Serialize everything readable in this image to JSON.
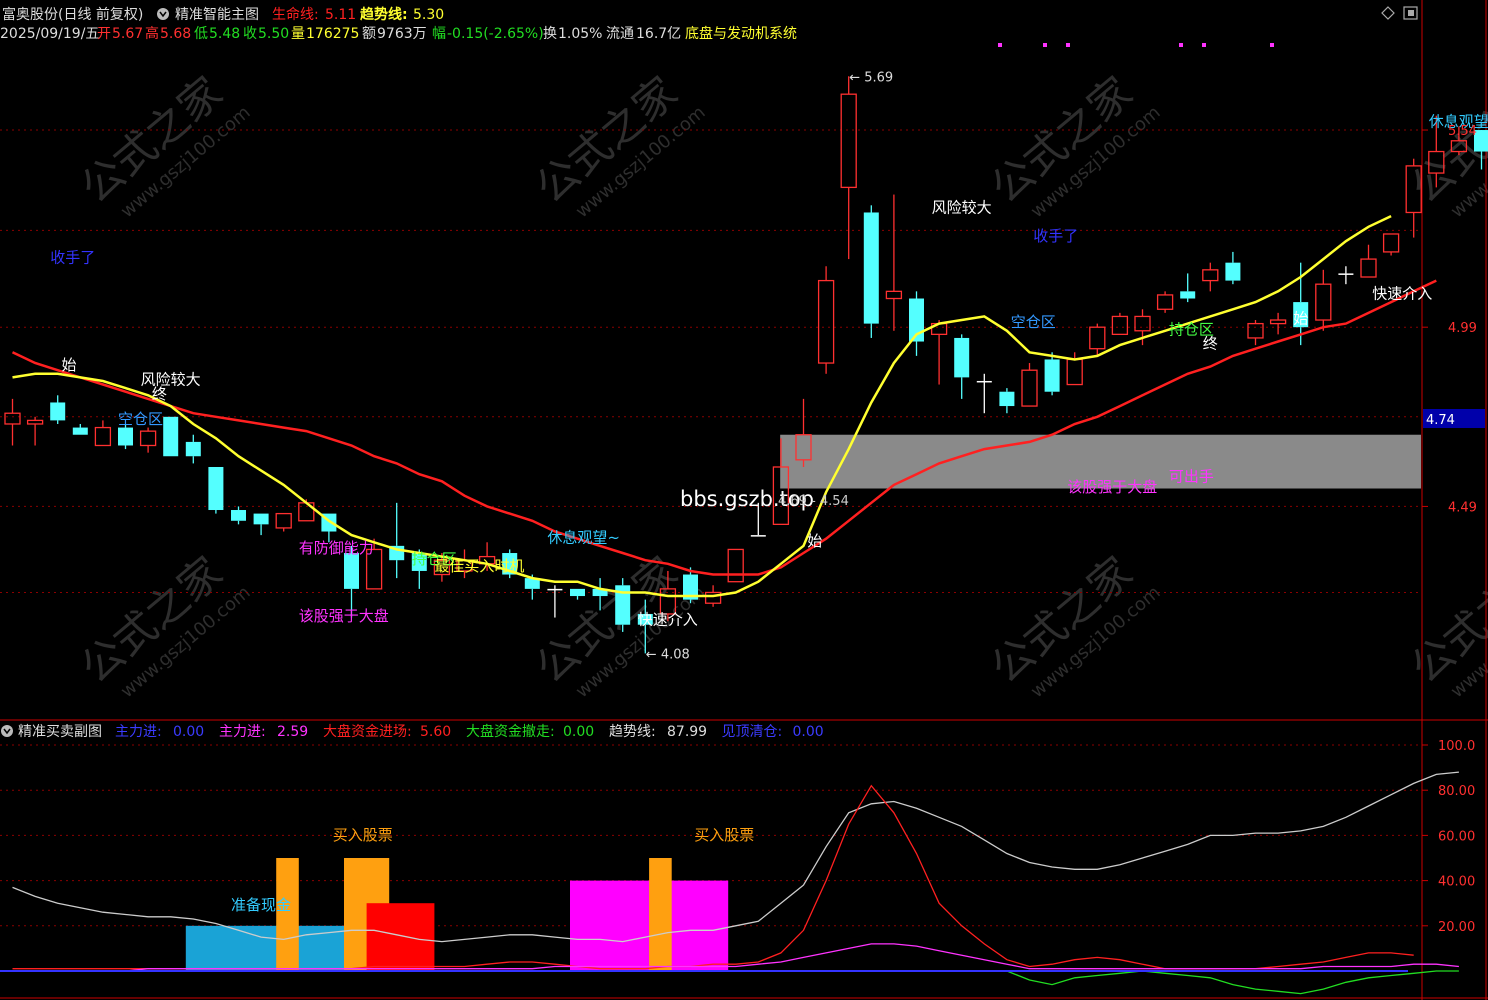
{
  "header": {
    "stock": "富奥股份(日线 前复权)",
    "indicator": "精准智能主图",
    "life_label": "生命线:",
    "life_value": "5.11",
    "trend_label": "趋势线:",
    "trend_value": "5.30",
    "date": "2025/09/19/五",
    "open_label": "开",
    "open": "5.67",
    "high_label": "高",
    "high": "5.68",
    "low_label": "低",
    "low": "5.48",
    "close_label": "收",
    "close": "5.50",
    "vol_label": "量",
    "vol": "176275",
    "amt_label": "额",
    "amt": "9763万",
    "chg_label": "幅",
    "chg": "-0.15(-2.65%)",
    "turn_label": "换",
    "turn": "1.05%",
    "float_label": "流通",
    "float": "16.7亿",
    "system": "底盘与发动机系统"
  },
  "sub_header": {
    "title": "精准买卖副图",
    "items": [
      {
        "label": "主力进:",
        "value": "0.00",
        "color": "#3b3bff"
      },
      {
        "label": "主力进:",
        "value": "2.59",
        "color": "#ff33ff"
      },
      {
        "label": "大盘资金进场:",
        "value": "5.60",
        "color": "#ff2020"
      },
      {
        "label": "大盘资金撤走:",
        "value": "0.00",
        "color": "#22dd22"
      },
      {
        "label": "趋势线:",
        "value": "87.99",
        "color": "#dddddd"
      },
      {
        "label": "见顶清仓:",
        "value": "0.00",
        "color": "#3b3bff"
      }
    ]
  },
  "watermark": {
    "text": "公式之家",
    "url": "www.gszj100.com"
  },
  "site_text": "bbs.gszb.top",
  "zone_text": "4.69 - 4.54",
  "colors": {
    "up": "#ff3030",
    "down": "#54ffff",
    "life": "#ff2020",
    "trend": "#ffff30",
    "grid": "#8b0000",
    "axis": "#cc0000"
  },
  "main_axis": {
    "ticks": [
      "5.54",
      "4.99",
      "4.49"
    ],
    "current": "4.74"
  },
  "sub_axis": {
    "ticks": [
      "100.0",
      "80.00",
      "60.00",
      "40.00",
      "20.00"
    ]
  },
  "chart_data": {
    "type": "candlestick",
    "ylim": [
      3.95,
      5.78
    ],
    "candles": [
      [
        4.72,
        4.75,
        4.66,
        4.79
      ],
      [
        4.72,
        4.73,
        4.66,
        4.74
      ],
      [
        4.78,
        4.73,
        4.72,
        4.8
      ],
      [
        4.71,
        4.69,
        4.69,
        4.72
      ],
      [
        4.66,
        4.71,
        4.66,
        4.73
      ],
      [
        4.71,
        4.66,
        4.65,
        4.72
      ],
      [
        4.66,
        4.7,
        4.64,
        4.71
      ],
      [
        4.74,
        4.63,
        4.63,
        4.74
      ],
      [
        4.67,
        4.63,
        4.61,
        4.69
      ],
      [
        4.6,
        4.48,
        4.47,
        4.6
      ],
      [
        4.48,
        4.45,
        4.44,
        4.49
      ],
      [
        4.47,
        4.44,
        4.41,
        4.47
      ],
      [
        4.43,
        4.47,
        4.42,
        4.47
      ],
      [
        4.45,
        4.5,
        4.45,
        4.51
      ],
      [
        4.47,
        4.42,
        4.39,
        4.47
      ],
      [
        4.36,
        4.26,
        4.18,
        4.38
      ],
      [
        4.26,
        4.37,
        4.26,
        4.4
      ],
      [
        4.38,
        4.34,
        4.29,
        4.5
      ],
      [
        4.36,
        4.31,
        4.26,
        4.37
      ],
      [
        4.3,
        4.34,
        4.28,
        4.36
      ],
      [
        4.31,
        4.34,
        4.29,
        4.37
      ],
      [
        4.33,
        4.35,
        4.31,
        4.39
      ],
      [
        4.36,
        4.3,
        4.29,
        4.37
      ],
      [
        4.29,
        4.26,
        4.23,
        4.3
      ],
      [
        4.26,
        4.26,
        4.18,
        4.27
      ],
      [
        4.26,
        4.24,
        4.23,
        4.26
      ],
      [
        4.26,
        4.24,
        4.2,
        4.29
      ],
      [
        4.27,
        4.16,
        4.14,
        4.29
      ],
      [
        4.19,
        4.16,
        4.08,
        4.23
      ],
      [
        4.19,
        4.26,
        4.17,
        4.31
      ],
      [
        4.3,
        4.23,
        4.22,
        4.32
      ],
      [
        4.22,
        4.25,
        4.21,
        4.27
      ],
      [
        4.28,
        4.37,
        4.28,
        4.37
      ],
      [
        4.41,
        4.41,
        4.41,
        4.5
      ],
      [
        4.44,
        4.6,
        4.44,
        4.68
      ],
      [
        4.62,
        4.69,
        4.6,
        4.79
      ],
      [
        4.89,
        5.12,
        4.86,
        5.16
      ],
      [
        5.38,
        5.64,
        5.18,
        5.69
      ],
      [
        5.31,
        5.0,
        4.96,
        5.33
      ],
      [
        5.07,
        5.09,
        4.98,
        5.36
      ],
      [
        5.07,
        4.95,
        4.91,
        5.09
      ],
      [
        4.97,
        5.0,
        4.83,
        5.01
      ],
      [
        4.96,
        4.85,
        4.79,
        4.97
      ],
      [
        4.84,
        4.84,
        4.75,
        4.86
      ],
      [
        4.81,
        4.77,
        4.75,
        4.82
      ],
      [
        4.77,
        4.87,
        4.77,
        4.89
      ],
      [
        4.9,
        4.81,
        4.8,
        4.92
      ],
      [
        4.83,
        4.9,
        4.83,
        4.92
      ],
      [
        4.93,
        4.99,
        4.91,
        5.0
      ],
      [
        4.97,
        5.02,
        4.97,
        5.03
      ],
      [
        4.98,
        5.02,
        4.94,
        5.04
      ],
      [
        5.04,
        5.08,
        5.03,
        5.09
      ],
      [
        5.09,
        5.07,
        5.06,
        5.14
      ],
      [
        5.12,
        5.15,
        5.09,
        5.17
      ],
      [
        5.17,
        5.12,
        5.11,
        5.2
      ],
      [
        4.96,
        5.0,
        4.94,
        5.01
      ],
      [
        5.0,
        5.01,
        4.97,
        5.03
      ],
      [
        5.06,
        4.99,
        4.94,
        5.17
      ],
      [
        5.01,
        5.11,
        4.98,
        5.15
      ],
      [
        5.14,
        5.14,
        5.11,
        5.16
      ],
      [
        5.13,
        5.18,
        5.13,
        5.22
      ],
      [
        5.2,
        5.25,
        5.19,
        5.25
      ],
      [
        5.31,
        5.44,
        5.24,
        5.46
      ],
      [
        5.42,
        5.48,
        5.38,
        5.58
      ],
      [
        5.48,
        5.51,
        5.47,
        5.55
      ],
      [
        5.54,
        5.48,
        5.43,
        5.53
      ]
    ],
    "life_line": [
      4.92,
      4.89,
      4.87,
      4.85,
      4.83,
      4.81,
      4.79,
      4.77,
      4.75,
      4.74,
      4.73,
      4.72,
      4.71,
      4.7,
      4.68,
      4.66,
      4.63,
      4.61,
      4.58,
      4.56,
      4.52,
      4.49,
      4.47,
      4.45,
      4.42,
      4.4,
      4.38,
      4.36,
      4.34,
      4.33,
      4.31,
      4.3,
      4.3,
      4.3,
      4.32,
      4.36,
      4.4,
      4.45,
      4.5,
      4.55,
      4.58,
      4.61,
      4.63,
      4.65,
      4.66,
      4.67,
      4.69,
      4.72,
      4.74,
      4.77,
      4.8,
      4.83,
      4.86,
      4.88,
      4.91,
      4.93,
      4.95,
      4.97,
      4.99,
      5.0,
      5.03,
      5.06,
      5.09,
      5.12
    ],
    "trend_line": [
      4.85,
      4.86,
      4.86,
      4.85,
      4.84,
      4.82,
      4.8,
      4.77,
      4.72,
      4.68,
      4.63,
      4.59,
      4.55,
      4.5,
      4.45,
      4.41,
      4.39,
      4.37,
      4.36,
      4.35,
      4.34,
      4.33,
      4.31,
      4.29,
      4.28,
      4.28,
      4.26,
      4.25,
      4.25,
      4.24,
      4.24,
      4.24,
      4.25,
      4.28,
      4.33,
      4.38,
      4.53,
      4.65,
      4.78,
      4.89,
      4.97,
      5.0,
      5.01,
      5.02,
      4.98,
      4.92,
      4.91,
      4.9,
      4.91,
      4.94,
      4.96,
      4.98,
      5.0,
      5.02,
      5.04,
      5.06,
      5.09,
      5.13,
      5.18,
      5.23,
      5.27,
      5.3
    ],
    "signal_zone": [
      4.54,
      4.69
    ],
    "high_mark": "5.69",
    "low_mark": "4.08",
    "labels": [
      {
        "text": "收手了",
        "idx": 2,
        "price": 5.17,
        "color": "#3333ff"
      },
      {
        "text": "风险较大",
        "idx": 6,
        "price": 4.83,
        "color": "#ffffff"
      },
      {
        "text": "始",
        "idx": 2.5,
        "price": 4.87,
        "color": "#ffffff"
      },
      {
        "text": "终",
        "idx": 6.5,
        "price": 4.79,
        "color": "#ffffff"
      },
      {
        "text": "空仓区",
        "idx": 5,
        "price": 4.72,
        "color": "#3399ff"
      },
      {
        "text": "有防御能力",
        "idx": 13,
        "price": 4.36,
        "color": "#ff33ff"
      },
      {
        "text": "持仓区",
        "idx": 18,
        "price": 4.33,
        "color": "#44ff44"
      },
      {
        "text": "最佳买入时机",
        "idx": 19,
        "price": 4.31,
        "color": "#ffff30"
      },
      {
        "text": "该股强于大盘",
        "idx": 13,
        "price": 4.17,
        "color": "#ff33ff"
      },
      {
        "text": "休息观望~",
        "idx": 24,
        "price": 4.39,
        "color": "#33ccff"
      },
      {
        "text": "快速介入",
        "idx": 28,
        "price": 4.16,
        "color": "#ffffff"
      },
      {
        "text": "始",
        "idx": 35.5,
        "price": 4.38,
        "color": "#ffffff"
      },
      {
        "text": "风险较大",
        "idx": 41,
        "price": 5.31,
        "color": "#ffffff"
      },
      {
        "text": "收手了",
        "idx": 45.5,
        "price": 5.23,
        "color": "#3333ff"
      },
      {
        "text": "空仓区",
        "idx": 44.5,
        "price": 4.99,
        "color": "#3399ff"
      },
      {
        "text": "该股强于大盘",
        "idx": 47,
        "price": 4.53,
        "color": "#ff33ff"
      },
      {
        "text": "可出手",
        "idx": 51.5,
        "price": 4.56,
        "color": "#ff33ff"
      },
      {
        "text": "持仓区",
        "idx": 51.5,
        "price": 4.97,
        "color": "#44ff44"
      },
      {
        "text": "终",
        "idx": 53,
        "price": 4.93,
        "color": "#ffffff"
      },
      {
        "text": "始",
        "idx": 57,
        "price": 5.0,
        "color": "#ffffff"
      },
      {
        "text": "快速介入",
        "idx": 60.5,
        "price": 5.07,
        "color": "#ffffff"
      },
      {
        "text": "休息观望~",
        "idx": 63,
        "price": 5.55,
        "color": "#33ccff"
      }
    ],
    "sub": {
      "ylim": [
        0,
        105
      ],
      "trend_line": [
        37,
        33,
        30,
        28,
        26,
        25,
        24,
        24,
        23,
        21,
        18,
        15,
        14,
        16,
        17,
        18,
        18,
        16,
        14,
        13,
        14,
        15,
        16,
        16,
        15,
        14,
        14,
        13,
        15,
        17,
        18,
        18,
        20,
        22,
        30,
        38,
        55,
        70,
        74,
        75,
        72,
        68,
        64,
        58,
        52,
        48,
        46,
        45,
        45,
        47,
        50,
        53,
        56,
        60,
        60,
        61,
        61,
        62,
        64,
        68,
        73,
        78,
        83,
        87,
        88
      ],
      "red_line": [
        1,
        1,
        1,
        1,
        1,
        1,
        1,
        1,
        1,
        1,
        1,
        1,
        1,
        1,
        1,
        1,
        2,
        2,
        2,
        2,
        2,
        3,
        4,
        4,
        3,
        2,
        1,
        1,
        1,
        2,
        2,
        3,
        3,
        4,
        8,
        18,
        40,
        65,
        82,
        70,
        52,
        30,
        20,
        12,
        5,
        2,
        3,
        5,
        6,
        5,
        3,
        1,
        1,
        1,
        1,
        1,
        2,
        3,
        4,
        6,
        8,
        8,
        7
      ],
      "magenta_line": [
        0,
        0,
        0,
        0,
        0,
        0,
        1,
        1,
        1,
        1,
        1,
        1,
        1,
        1,
        1,
        1,
        1,
        1,
        1,
        1,
        1,
        1,
        1,
        1,
        2,
        2,
        2,
        2,
        2,
        2,
        2,
        2,
        2,
        3,
        4,
        6,
        8,
        10,
        12,
        12,
        11,
        9,
        7,
        5,
        3,
        1,
        1,
        1,
        1,
        1,
        1,
        1,
        1,
        1,
        1,
        1,
        1,
        1,
        2,
        2,
        2,
        2,
        3,
        3,
        2
      ],
      "green_line": [
        0,
        0,
        0,
        0,
        0,
        0,
        0,
        0,
        0,
        0,
        0,
        0,
        0,
        0,
        0,
        0,
        0,
        0,
        0,
        0,
        0,
        0,
        0,
        0,
        0,
        0,
        0,
        0,
        0,
        0,
        0,
        0,
        0,
        0,
        0,
        0,
        0,
        0,
        0,
        0,
        0,
        0,
        0,
        0,
        0,
        -4,
        -6,
        -3,
        -2,
        -1,
        0,
        -1,
        -2,
        -3,
        -6,
        -8,
        -9,
        -10,
        -8,
        -5,
        -3,
        -2,
        -1,
        0,
        0
      ],
      "bars": [
        {
          "from": 8,
          "to": 15,
          "value": 20,
          "color": "#1aa3d6"
        },
        {
          "from": 12,
          "to": 13,
          "value": 50,
          "color": "#ffa010"
        },
        {
          "from": 15,
          "to": 17,
          "value": 50,
          "color": "#ffa010"
        },
        {
          "from": 16,
          "to": 19,
          "value": 30,
          "color": "#ff0000"
        },
        {
          "from": 25,
          "to": 32,
          "value": 40,
          "color": "#ff00ff"
        },
        {
          "from": 28.5,
          "to": 29.5,
          "value": 50,
          "color": "#ffa010"
        }
      ],
      "labels": [
        {
          "text": "准备现金",
          "idx": 10,
          "value": 27,
          "color": "#33ccff"
        },
        {
          "text": "买入股票",
          "idx": 14.5,
          "value": 58,
          "color": "#ffa010"
        },
        {
          "text": "买入股票",
          "idx": 30.5,
          "value": 58,
          "color": "#ffa010"
        }
      ]
    }
  }
}
